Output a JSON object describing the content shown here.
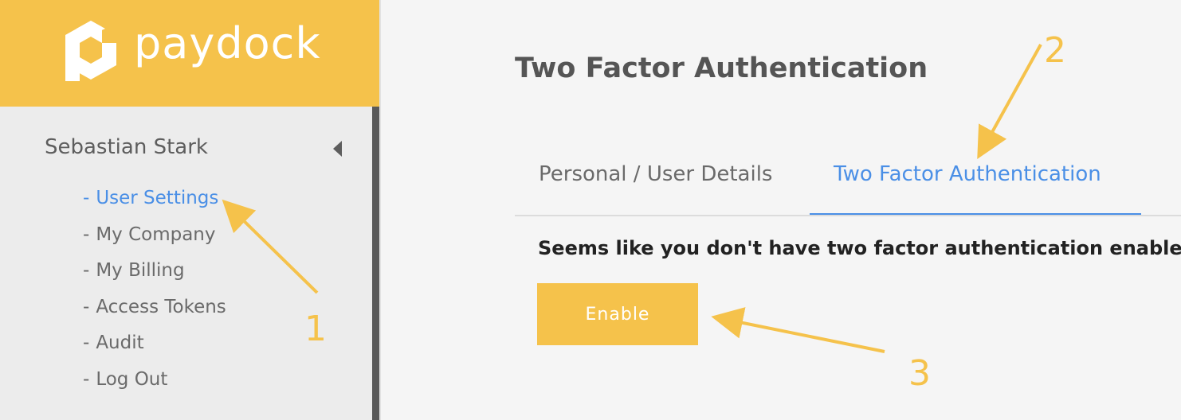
{
  "brand": {
    "name": "paydock",
    "logo_color": "#f5c24b",
    "accent": "#4a8fe6"
  },
  "sidebar": {
    "user_name": "Sebastian Stark",
    "items": [
      {
        "label": "User Settings",
        "active": true
      },
      {
        "label": "My Company",
        "active": false
      },
      {
        "label": "My Billing",
        "active": false
      },
      {
        "label": "Access Tokens",
        "active": false
      },
      {
        "label": "Audit",
        "active": false
      },
      {
        "label": "Log Out",
        "active": false
      }
    ],
    "dash": "-"
  },
  "main": {
    "title": "Two Factor Authentication",
    "tabs": [
      {
        "label": "Personal / User Details",
        "active": false
      },
      {
        "label": "Two Factor Authentication",
        "active": true
      }
    ],
    "notice": "Seems like you don't have two factor authentication enabled",
    "enable_label": "Enable"
  },
  "annotations": [
    "1",
    "2",
    "3"
  ]
}
